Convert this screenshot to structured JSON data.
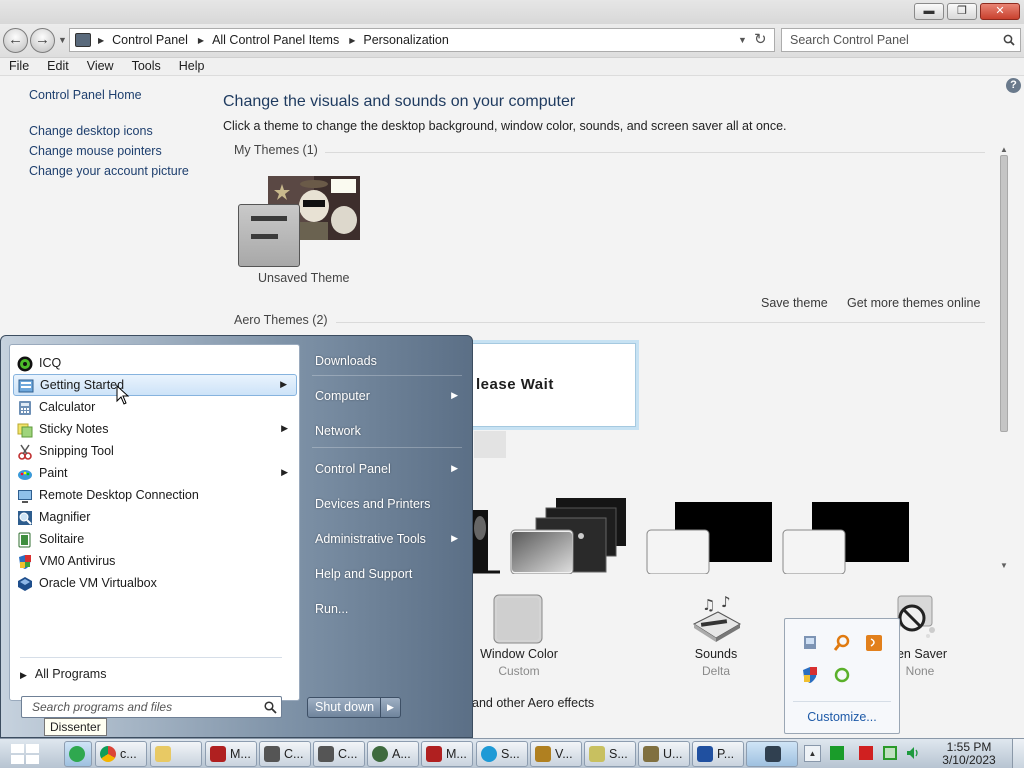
{
  "window": {
    "caption_buttons": [
      "minimize",
      "restore",
      "close"
    ]
  },
  "address": {
    "breadcrumbs": [
      "Control Panel",
      "All Control Panel Items",
      "Personalization"
    ],
    "search_placeholder": "Search Control Panel"
  },
  "menubar": [
    "File",
    "Edit",
    "View",
    "Tools",
    "Help"
  ],
  "sidebar": {
    "home": "Control Panel Home",
    "links": [
      "Change desktop icons",
      "Change mouse pointers",
      "Change your account picture"
    ]
  },
  "main": {
    "heading": "Change the visuals and sounds on your computer",
    "subheading": "Click a theme to change the desktop background, window color, sounds, and screen saver all at once.",
    "my_themes_label": "My Themes (1)",
    "unsaved_theme": "Unsaved Theme",
    "save_theme": "Save theme",
    "get_more_themes": "Get more themes online",
    "aero_themes_label": "Aero Themes (2)",
    "please_wait": "lease Wait",
    "window_color_label": "Window Color",
    "window_color_value": "Custom",
    "sounds_label": "Sounds",
    "sounds_value": "Delta",
    "screen_saver_label": "en Saver",
    "screen_saver_value": "None",
    "aero_effects_text": "and other Aero effects"
  },
  "tray_popup": {
    "customize": "Customize..."
  },
  "start_menu": {
    "programs": [
      {
        "label": "ICQ",
        "icon": "icq-icon",
        "arrow": false
      },
      {
        "label": "Getting Started",
        "icon": "getting-started-icon",
        "arrow": true,
        "selected": true
      },
      {
        "label": "Calculator",
        "icon": "calculator-icon",
        "arrow": false
      },
      {
        "label": "Sticky Notes",
        "icon": "sticky-notes-icon",
        "arrow": true
      },
      {
        "label": "Snipping Tool",
        "icon": "snipping-tool-icon",
        "arrow": false
      },
      {
        "label": "Paint",
        "icon": "paint-icon",
        "arrow": true
      },
      {
        "label": "Remote Desktop Connection",
        "icon": "remote-desktop-icon",
        "arrow": false
      },
      {
        "label": "Magnifier",
        "icon": "magnifier-icon",
        "arrow": false
      },
      {
        "label": "Solitaire",
        "icon": "solitaire-icon",
        "arrow": false
      },
      {
        "label": "VM0 Antivirus",
        "icon": "antivirus-shield-icon",
        "arrow": false
      },
      {
        "label": "Oracle VM Virtualbox",
        "icon": "virtualbox-icon",
        "arrow": false
      }
    ],
    "all_programs": "All Programs",
    "search_placeholder": "Search programs and files",
    "right_items": [
      {
        "label": "Downloads",
        "arrow": false
      },
      {
        "label": "Computer",
        "arrow": true
      },
      {
        "label": "Network",
        "arrow": false
      },
      {
        "label": "Control Panel",
        "arrow": true
      },
      {
        "label": "Devices and Printers",
        "arrow": false
      },
      {
        "label": "Administrative Tools",
        "arrow": true
      },
      {
        "label": "Help and Support",
        "arrow": false
      },
      {
        "label": "Run...",
        "arrow": false
      }
    ],
    "shutdown": "Shut down",
    "tooltip": "Dissenter"
  },
  "taskbar": {
    "buttons": [
      {
        "label": "",
        "icon": "dissenter-icon",
        "color": "#2fa84f"
      },
      {
        "label": "c...",
        "icon": "chrome-icon",
        "color": "#e0a020"
      },
      {
        "label": "",
        "icon": "folder-icon",
        "color": "#e8c964"
      },
      {
        "label": "M...",
        "icon": "word-doc-icon",
        "color": "#b02020"
      },
      {
        "label": "C...",
        "icon": "skull-icon",
        "color": "#555555"
      },
      {
        "label": "C...",
        "icon": "skull-icon",
        "color": "#555555"
      },
      {
        "label": "A...",
        "icon": "globe-icon",
        "color": "#3e6a3e"
      },
      {
        "label": "M...",
        "icon": "doc-icon",
        "color": "#b02020"
      },
      {
        "label": "S...",
        "icon": "skype-icon",
        "color": "#1e9ad6"
      },
      {
        "label": "V...",
        "icon": "shield-icon",
        "color": "#b08020"
      },
      {
        "label": "S...",
        "icon": "sticky-icon",
        "color": "#c8c060"
      },
      {
        "label": "U...",
        "icon": "utility-icon",
        "color": "#807040"
      },
      {
        "label": "P...",
        "icon": "paint-icon",
        "color": "#2050a0"
      },
      {
        "label": "",
        "icon": "monitor-icon",
        "color": "#304050"
      }
    ],
    "clock_time": "1:55 PM",
    "clock_date": "3/10/2023"
  }
}
